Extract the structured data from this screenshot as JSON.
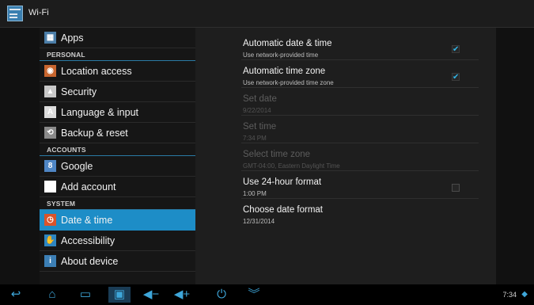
{
  "actionbar": {
    "title": "Wi-Fi",
    "icon": "settings-icon"
  },
  "sidebar": {
    "items": [
      {
        "label": "Apps",
        "icon": "apps-icon",
        "glyph": "▦",
        "color": "#4b7ea8"
      },
      {
        "header": "PERSONAL"
      },
      {
        "label": "Location access",
        "icon": "location-icon",
        "glyph": "◉",
        "color": "#c8662f"
      },
      {
        "label": "Security",
        "icon": "lock-icon",
        "glyph": "▲",
        "color": "#c9c9c9"
      },
      {
        "label": "Language & input",
        "icon": "language-icon",
        "glyph": "A",
        "color": "#dddddd"
      },
      {
        "label": "Backup & reset",
        "icon": "backup-icon",
        "glyph": "⟲",
        "color": "#8a8a8a"
      },
      {
        "header": "ACCOUNTS"
      },
      {
        "label": "Google",
        "icon": "google-icon",
        "glyph": "8",
        "color": "#4f86c5"
      },
      {
        "label": "Add account",
        "icon": "plus-icon",
        "glyph": "+",
        "color": "#ffffff"
      },
      {
        "header": "SYSTEM"
      },
      {
        "label": "Date & time",
        "icon": "clock-icon",
        "glyph": "◷",
        "color": "#d9542b",
        "selected": true
      },
      {
        "label": "Accessibility",
        "icon": "accessibility-icon",
        "glyph": "✋",
        "color": "#2e86c1"
      },
      {
        "label": "About device",
        "icon": "info-icon",
        "glyph": "i",
        "color": "#3c7fb5"
      }
    ]
  },
  "settings": {
    "rows": [
      {
        "title": "Automatic date & time",
        "summary": "Use network-provided time",
        "checkbox": true,
        "checked": true
      },
      {
        "title": "Automatic time zone",
        "summary": "Use network-provided time zone",
        "checkbox": true,
        "checked": true
      },
      {
        "title": "Set date",
        "summary": "9/22/2014",
        "disabled": true
      },
      {
        "title": "Set time",
        "summary": "7:34 PM",
        "disabled": true
      },
      {
        "title": "Select time zone",
        "summary": "GMT-04:00, Eastern Daylight Time",
        "disabled": true
      },
      {
        "title": "Use 24-hour format",
        "summary": "1:00 PM",
        "checkbox": true,
        "checked": false
      },
      {
        "title": "Choose date format",
        "summary": "12/31/2014"
      }
    ]
  },
  "navbar": {
    "buttons": [
      {
        "name": "back-button",
        "icon": "back-icon",
        "glyph": "↩"
      },
      {
        "name": "home-button",
        "icon": "home-icon",
        "glyph": "⌂"
      },
      {
        "name": "recents-button",
        "icon": "recents-icon",
        "glyph": "▭"
      },
      {
        "name": "screenshot-button",
        "icon": "screenshot-icon",
        "glyph": "▣",
        "active": true
      },
      {
        "name": "volume-down-button",
        "icon": "volume-down-icon",
        "glyph": "◀−"
      },
      {
        "name": "volume-up-button",
        "icon": "volume-up-icon",
        "glyph": "◀+"
      },
      {
        "name": "power-button",
        "icon": "power-icon",
        "glyph": "⏻"
      },
      {
        "name": "menu-button",
        "icon": "chevron-down-icon",
        "glyph": "︾"
      }
    ],
    "clock": "7:34",
    "status_icon": "wifi-icon",
    "accent": "#33b5e5"
  }
}
